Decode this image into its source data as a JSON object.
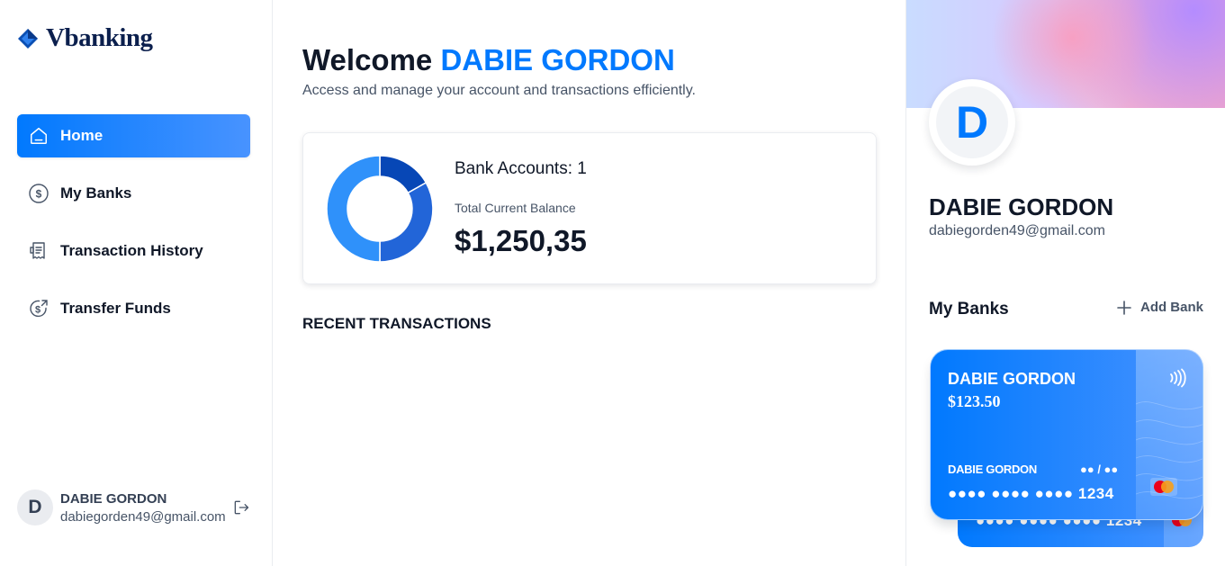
{
  "app": {
    "name": "Vbanking"
  },
  "sidebar": {
    "items": [
      {
        "label": "Home",
        "icon": "home-icon",
        "active": true
      },
      {
        "label": "My Banks",
        "icon": "dollar-circle-icon",
        "active": false
      },
      {
        "label": "Transaction History",
        "icon": "receipt-icon",
        "active": false
      },
      {
        "label": "Transfer Funds",
        "icon": "money-send-icon",
        "active": false
      }
    ],
    "footer": {
      "initial": "D",
      "name": "DABIE GORDON",
      "email": "dabiegorden49@gmail.com",
      "logout_icon": "logout-icon"
    }
  },
  "main": {
    "welcome_prefix": "Welcome",
    "user_name": "DABIE GORDON",
    "subtitle": "Access and manage your account and transactions efficiently.",
    "balance_card": {
      "bank_accounts_label": "Bank Accounts: 1",
      "total_balance_label": "Total Current Balance",
      "total_balance_value": "$1,250,35"
    },
    "recent_transactions_title": "RECENT TRANSACTIONS"
  },
  "right_sidebar": {
    "profile": {
      "initial": "D",
      "name": "DABIE GORDON",
      "email": "dabiegorden49@gmail.com"
    },
    "my_banks_title": "My Banks",
    "add_bank_label": "Add Bank",
    "card": {
      "bank_name": "DABIE GORDON",
      "balance": "$123.50",
      "holder": "DABIE GORDON",
      "expiry": "●● / ●●",
      "number": "●●●● ●●●● ●●●● 1234"
    },
    "card_back": {
      "number": "●●●● ●●●● ●●●● 1234"
    }
  },
  "colors": {
    "accent": "#0179fe",
    "donut_segments": [
      "#0747b6",
      "#2265d8",
      "#2f91fa"
    ]
  }
}
